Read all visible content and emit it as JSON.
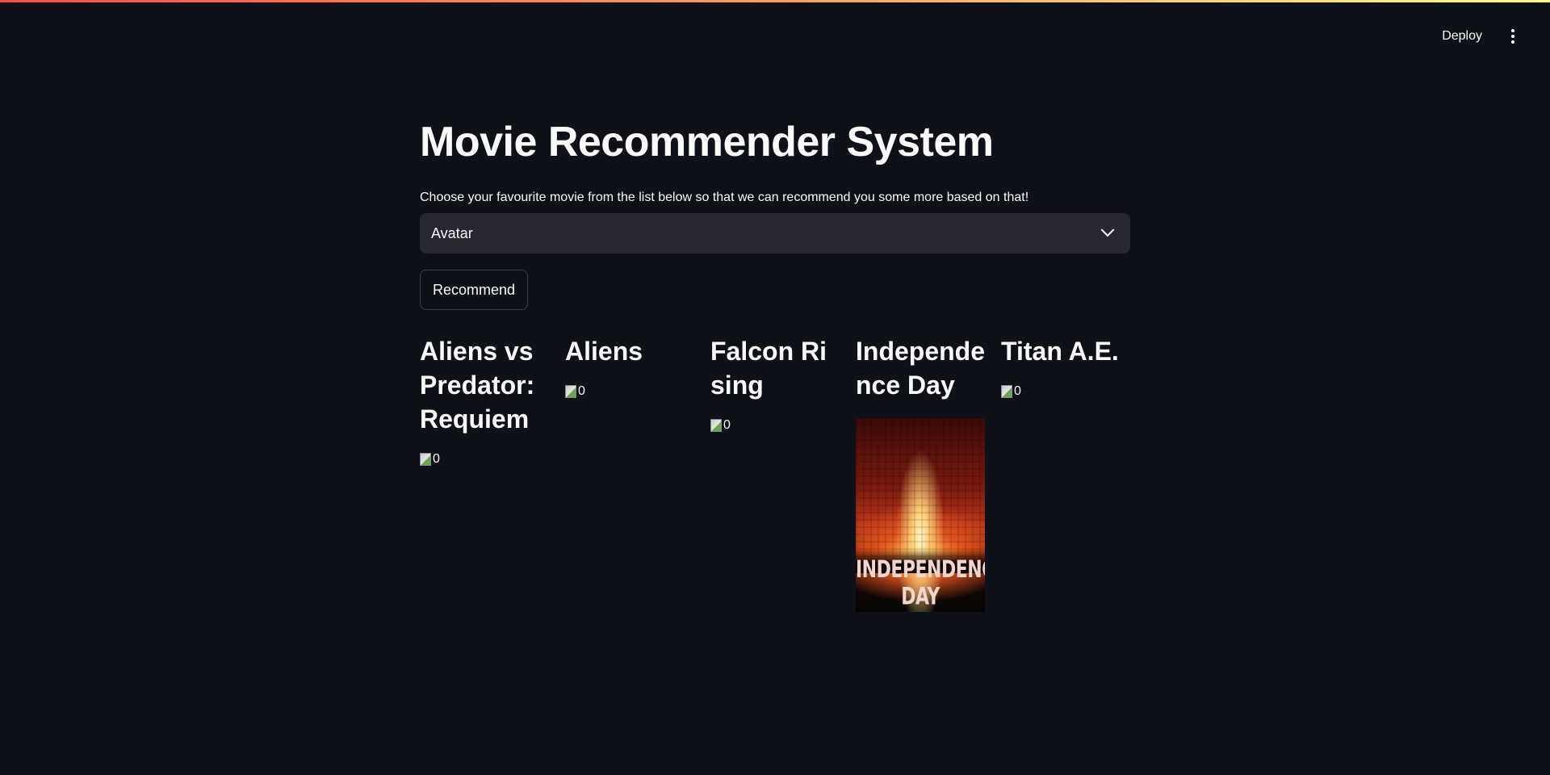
{
  "header": {
    "deploy_label": "Deploy",
    "menu_icon": "kebab-menu-icon"
  },
  "main": {
    "title": "Movie Recommender System",
    "select_label": "Choose your favourite movie from the list below so that we can recommend you some more based on that!",
    "select_value": "Avatar",
    "recommend_label": "Recommend"
  },
  "recommendations": [
    {
      "title": "Aliens vs Predator: Requiem",
      "poster_alt": "0",
      "poster_loaded": false
    },
    {
      "title": "Aliens",
      "poster_alt": "0",
      "poster_loaded": false
    },
    {
      "title": "Falcon Rising",
      "poster_alt": "0",
      "poster_loaded": false
    },
    {
      "title": "Independence Day",
      "poster_text": "INDEPENDENCE DAY",
      "poster_loaded": true
    },
    {
      "title": "Titan A.E.",
      "poster_alt": "0",
      "poster_loaded": false
    }
  ],
  "colors": {
    "background": "#0e1117",
    "select_bg": "#262730",
    "text": "#fafafa"
  }
}
